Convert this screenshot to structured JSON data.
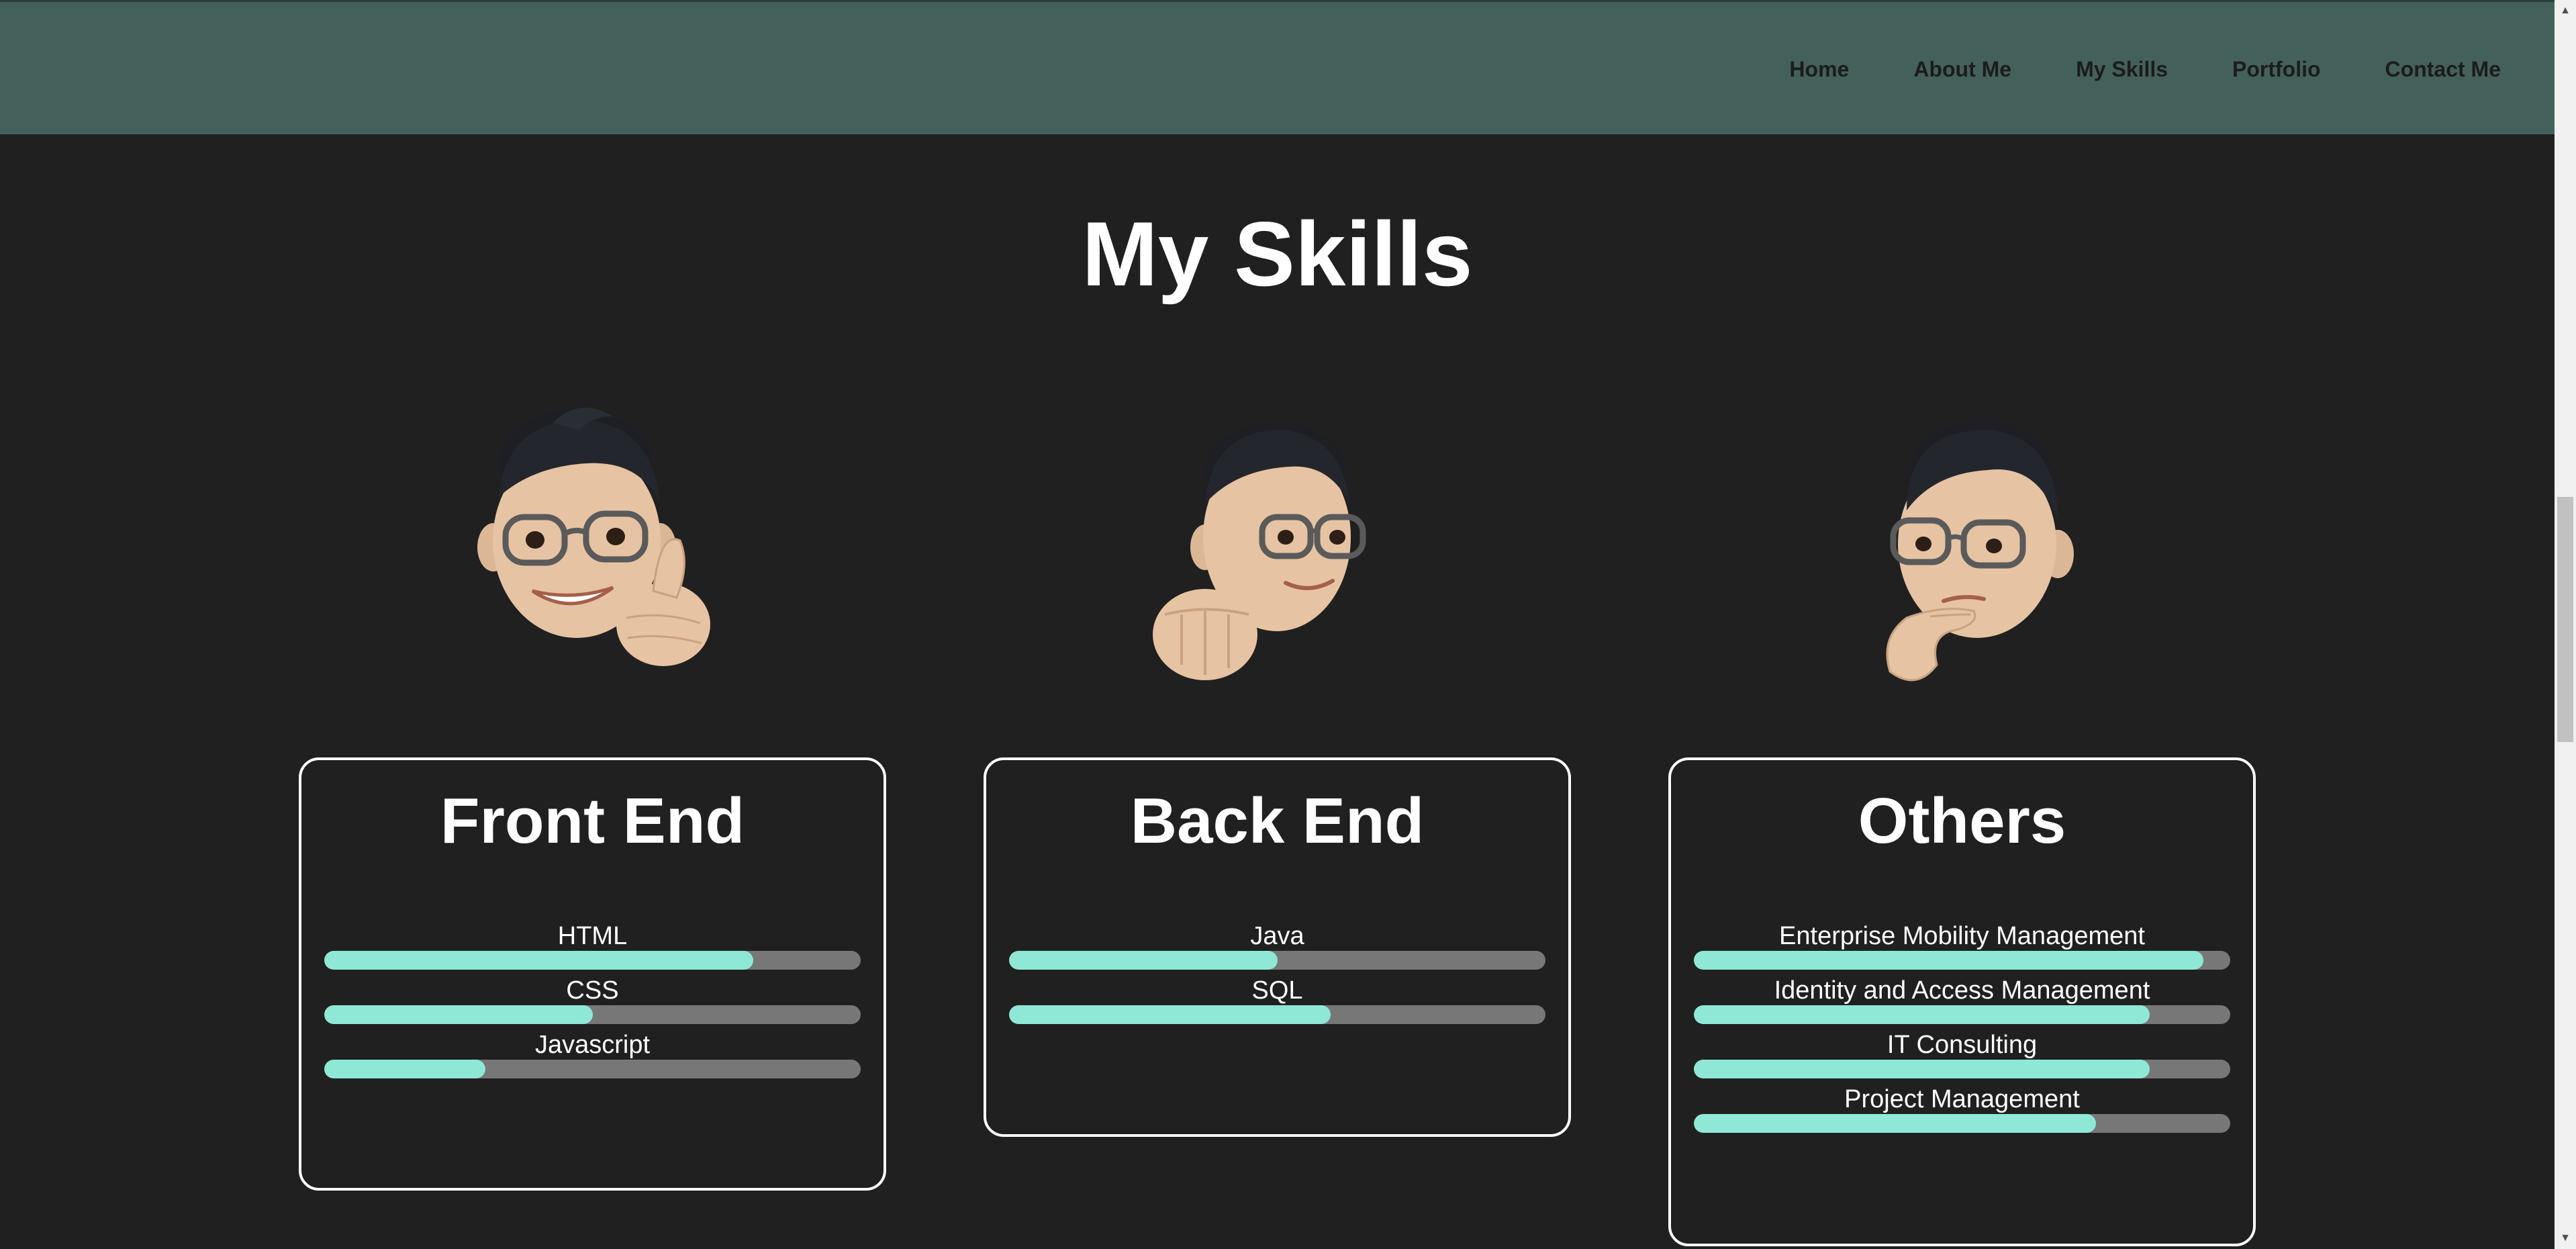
{
  "nav": {
    "items": [
      {
        "label": "Home"
      },
      {
        "label": "About Me"
      },
      {
        "label": "My Skills"
      },
      {
        "label": "Portfolio"
      },
      {
        "label": "Contact Me"
      }
    ]
  },
  "main": {
    "title": "My Skills",
    "cards": [
      {
        "title": "Front End",
        "skills": [
          {
            "name": "HTML",
            "level": 0.8
          },
          {
            "name": "CSS",
            "level": 0.5
          },
          {
            "name": "Javascript",
            "level": 0.3
          }
        ]
      },
      {
        "title": "Back End",
        "skills": [
          {
            "name": "Java",
            "level": 0.5
          },
          {
            "name": "SQL",
            "level": 0.6
          }
        ]
      },
      {
        "title": "Others",
        "skills": [
          {
            "name": "Enterprise Mobility Management",
            "level": 0.95
          },
          {
            "name": "Identity and Access Management",
            "level": 0.85
          },
          {
            "name": "IT Consulting",
            "level": 0.85
          },
          {
            "name": "Project Management",
            "level": 0.75
          }
        ]
      }
    ]
  },
  "colors": {
    "background": "#202020",
    "navbar": "#44605b",
    "bar_fill": "#8ee8d5",
    "bar_track": "#777777"
  }
}
